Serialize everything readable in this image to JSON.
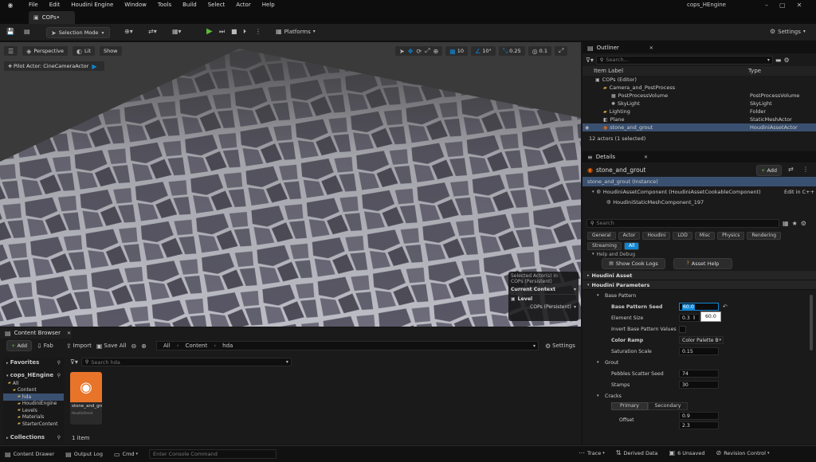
{
  "app": {
    "title": "cops_HEngine",
    "tab": "COPs•"
  },
  "menu": [
    "File",
    "Edit",
    "Houdini Engine",
    "Window",
    "Tools",
    "Build",
    "Select",
    "Actor",
    "Help"
  ],
  "toolbar": {
    "selection_mode": "Selection Mode",
    "platforms": "Platforms",
    "settings": "Settings"
  },
  "viewport": {
    "perspective": "Perspective",
    "lit": "Lit",
    "show": "Show",
    "pilot": "Pilot Actor: CineCameraActor",
    "grid": "10",
    "angle": "10°",
    "scale": "0.25",
    "speed": "0.1",
    "context": {
      "selected": "Selected Actor(s) in",
      "persistent": "COPs (Persistent)",
      "current": "Current Context",
      "level": "Level",
      "level_value": "COPs (Persistent)"
    }
  },
  "outliner": {
    "title": "Outliner",
    "search": "Search...",
    "col_label": "Item Label",
    "col_type": "Type",
    "rows": [
      {
        "label": "COPs (Editor)",
        "type": "",
        "indent": 1,
        "icon": "level-icon"
      },
      {
        "label": "Camera_and_PostProcess",
        "type": "",
        "indent": 2,
        "icon": "folder-icon"
      },
      {
        "label": "PostProcessVolume",
        "type": "PostProcessVolume",
        "indent": 3,
        "icon": "volume-icon"
      },
      {
        "label": "SkyLight",
        "type": "SkyLight",
        "indent": 3,
        "icon": "light-icon"
      },
      {
        "label": "Lighting",
        "type": "Folder",
        "indent": 2,
        "icon": "folder-icon"
      },
      {
        "label": "Plane",
        "type": "StaticMeshActor",
        "indent": 2,
        "icon": "mesh-icon"
      },
      {
        "label": "stone_and_grout",
        "type": "HoudiniAssetActor",
        "indent": 2,
        "icon": "houdini-icon",
        "selected": true
      }
    ],
    "count": "12 actors (1 selected)"
  },
  "details": {
    "title": "Details",
    "actor": "stone_and_grout",
    "add": "Add",
    "instance": "stone_and_grout (Instance)",
    "component": "HoudiniAssetComponent (HoudiniAssetCookableComponent)",
    "edit_cpp": "Edit in C++",
    "subcomponent": "HoudiniStaticMeshComponent_197",
    "search": "Search",
    "filters": [
      "General",
      "Actor",
      "Houdini",
      "LOD",
      "Misc",
      "Physics",
      "Rendering"
    ],
    "filters2": [
      "Streaming",
      "All"
    ],
    "help_debug": "Help and Debug",
    "show_cook_logs": "Show Cook Logs",
    "asset_help": "Asset Help",
    "houdini_asset": "Houdini Asset",
    "houdini_params": "Houdini Parameters",
    "base_pattern": "Base Pattern",
    "params": {
      "seed_label": "Base Pattern Seed",
      "seed_val": "60.0",
      "tooltip": "60.0",
      "elem_label": "Element Size",
      "elem_val": "0.3",
      "invert_label": "Invert Base Pattern Values",
      "ramp_label": "Color Ramp",
      "ramp_val": "Color Palette B",
      "sat_label": "Saturation Scale",
      "sat_val": "0.15"
    },
    "grout": "Grout",
    "grout_params": {
      "pebbles_label": "Pebbles Scatter Seed",
      "pebbles_val": "74",
      "stamps_label": "Stamps",
      "stamps_val": "30"
    },
    "cracks": "Cracks",
    "primary": "Primary",
    "secondary": "Secondary",
    "offset_label": "Offset",
    "offset_val1": "0.9",
    "offset_val2": "2.3"
  },
  "content": {
    "title": "Content Browser",
    "add": "Add",
    "fab": "Fab",
    "import": "Import",
    "save_all": "Save All",
    "path": [
      "All",
      "Content",
      "hda"
    ],
    "settings": "Settings",
    "favorites": "Favorites",
    "project": "cops_HEngine",
    "search": "Search hda",
    "tree": [
      {
        "label": "All",
        "indent": 0
      },
      {
        "label": "Content",
        "indent": 1
      },
      {
        "label": "hda",
        "indent": 2,
        "selected": true
      },
      {
        "label": "HoudiniEngine",
        "indent": 2
      },
      {
        "label": "Levels",
        "indent": 2
      },
      {
        "label": "Materials",
        "indent": 2
      },
      {
        "label": "StarterContent",
        "indent": 2
      }
    ],
    "collections": "Collections",
    "asset": {
      "name": "stone_and_grout",
      "type": "HoudiniAsset"
    },
    "count": "1 item"
  },
  "status": {
    "drawer": "Content Drawer",
    "output": "Output Log",
    "cmd": "Cmd",
    "console": "Enter Console Command",
    "trace": "Trace",
    "derived": "Derived Data",
    "unsaved": "6 Unsaved",
    "revision": "Revision Control"
  },
  "colors": {
    "accent": "#0e86d4",
    "selection": "#3a5070",
    "play": "#5dbb3a"
  }
}
